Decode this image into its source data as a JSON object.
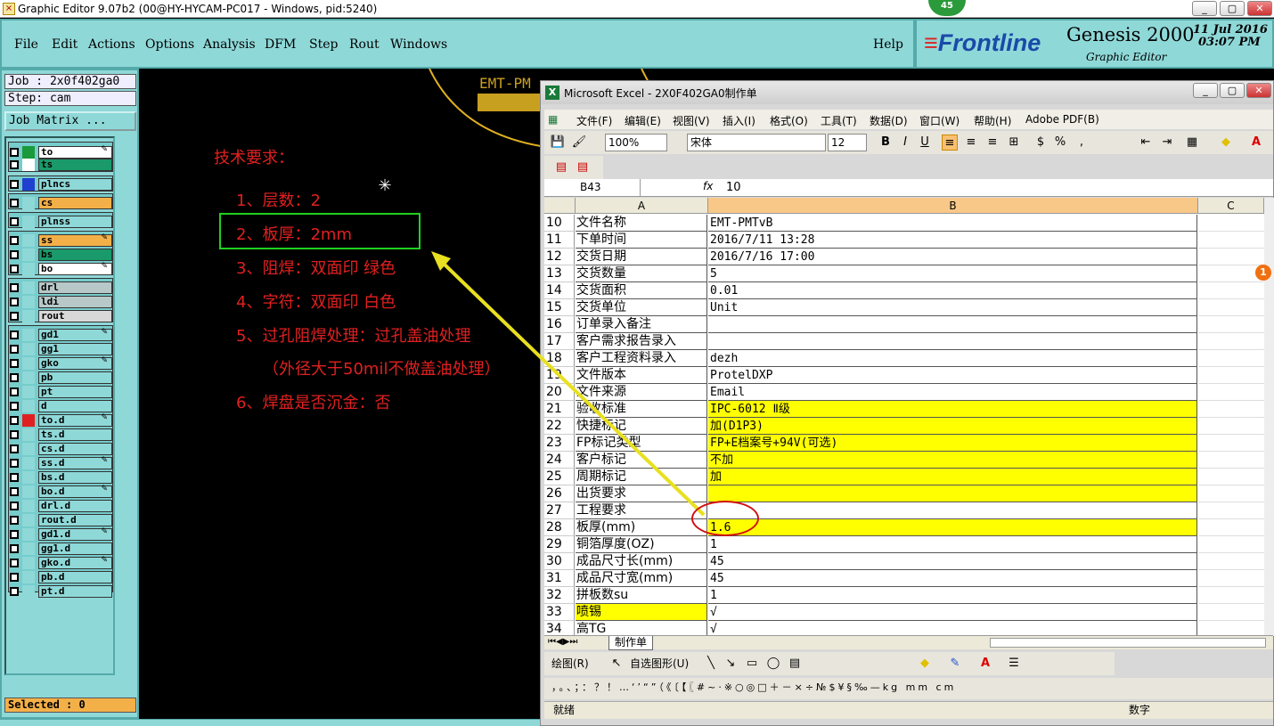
{
  "genesis": {
    "title": "Graphic Editor 9.07b2 (00@HY-HYCAM-PC017 - Windows, pid:5240)",
    "badge": "45",
    "menu": [
      "File",
      "Edit",
      "Actions",
      "Options",
      "Analysis",
      "DFM",
      "Step",
      "Rout",
      "Windows"
    ],
    "help": "Help",
    "brand": "Frontline",
    "product": "Genesis 2000",
    "product_sub": "Graphic Editor",
    "date": "11 Jul 2016",
    "time": "03:07 PM",
    "job": "Job : 2x0f402ga0",
    "step": "Step: cam",
    "job_matrix": "Job Matrix ...",
    "selected": "Selected : 0",
    "layers": [
      {
        "name": "to",
        "color": "#ffffff",
        "swatch": "#1a9a3a",
        "pen": true
      },
      {
        "name": "ts",
        "color": "#1a9a6a",
        "swatch": "#ffffff",
        "pen": false
      },
      {
        "name": "plncs",
        "color": "#8fd8d8",
        "swatch": "#2040d0",
        "pen": false
      },
      {
        "name": "cs",
        "color": "#f4b048",
        "swatch": "#8fd8d8",
        "pen": false
      },
      {
        "name": "plnss",
        "color": "#8fd8d8",
        "swatch": "#8fd8d8",
        "pen": false
      },
      {
        "name": "ss",
        "color": "#f4b048",
        "swatch": "#8fd8d8",
        "pen": true
      },
      {
        "name": "bs",
        "color": "#1a9a6a",
        "swatch": "#8fd8d8",
        "pen": false
      },
      {
        "name": "bo",
        "color": "#ffffff",
        "swatch": "#8fd8d8",
        "pen": true
      },
      {
        "name": "drl",
        "color": "#b8c8c8",
        "swatch": "#8fd8d8",
        "pen": false
      },
      {
        "name": "ldi",
        "color": "#b8c8c8",
        "swatch": "#8fd8d8",
        "pen": false
      },
      {
        "name": "rout",
        "color": "#d8d8d8",
        "swatch": "#8fd8d8",
        "pen": false
      },
      {
        "name": "gd1",
        "color": "#8fd8d8",
        "swatch": "#8fd8d8",
        "pen": true
      },
      {
        "name": "gg1",
        "color": "#8fd8d8",
        "swatch": "#8fd8d8",
        "pen": false
      },
      {
        "name": "gko",
        "color": "#8fd8d8",
        "swatch": "#8fd8d8",
        "pen": true
      },
      {
        "name": "pb",
        "color": "#8fd8d8",
        "swatch": "#8fd8d8",
        "pen": false
      },
      {
        "name": "pt",
        "color": "#8fd8d8",
        "swatch": "#8fd8d8",
        "pen": false
      },
      {
        "name": "d",
        "color": "#8fd8d8",
        "swatch": "#8fd8d8",
        "pen": false
      },
      {
        "name": "to.d",
        "color": "#8fd8d8",
        "swatch": "#e02020",
        "pen": true
      },
      {
        "name": "ts.d",
        "color": "#8fd8d8",
        "swatch": "#8fd8d8",
        "pen": false
      },
      {
        "name": "cs.d",
        "color": "#8fd8d8",
        "swatch": "#8fd8d8",
        "pen": false
      },
      {
        "name": "ss.d",
        "color": "#8fd8d8",
        "swatch": "#8fd8d8",
        "pen": true
      },
      {
        "name": "bs.d",
        "color": "#8fd8d8",
        "swatch": "#8fd8d8",
        "pen": false
      },
      {
        "name": "bo.d",
        "color": "#8fd8d8",
        "swatch": "#8fd8d8",
        "pen": true
      },
      {
        "name": "drl.d",
        "color": "#8fd8d8",
        "swatch": "#8fd8d8",
        "pen": false
      },
      {
        "name": "rout.d",
        "color": "#8fd8d8",
        "swatch": "#8fd8d8",
        "pen": false
      },
      {
        "name": "gd1.d",
        "color": "#8fd8d8",
        "swatch": "#8fd8d8",
        "pen": true
      },
      {
        "name": "gg1.d",
        "color": "#8fd8d8",
        "swatch": "#8fd8d8",
        "pen": false
      },
      {
        "name": "gko.d",
        "color": "#8fd8d8",
        "swatch": "#8fd8d8",
        "pen": true
      },
      {
        "name": "pb.d",
        "color": "#8fd8d8",
        "swatch": "#8fd8d8",
        "pen": false
      },
      {
        "name": "pt.d",
        "color": "#8fd8d8",
        "swatch": "#8fd8d8",
        "pen": false
      }
    ],
    "board_label": "EMT-PM",
    "tech_heading": "技术要求：",
    "tech_lines": [
      "1、层数：2",
      "2、板厚：2mm",
      "3、阻焊：双面印 绿色",
      "4、字符：双面印 白色",
      "5、过孔阻焊处理：过孔盖油处理",
      "（外径大于50mil不做盖油处理）",
      "6、焊盘是否沉金：否"
    ]
  },
  "excel": {
    "title": "Microsoft Excel - 2X0F402GA0制作单",
    "menu": [
      "文件(F)",
      "编辑(E)",
      "视图(V)",
      "插入(I)",
      "格式(O)",
      "工具(T)",
      "数据(D)",
      "窗口(W)",
      "帮助(H)",
      "Adobe PDF(B)"
    ],
    "zoom": "100%",
    "font": "宋体",
    "font_size": "12",
    "name_box": "B43",
    "fx": "fx",
    "formula_value": "10",
    "columns": [
      "A",
      "B",
      "C"
    ],
    "rows": [
      {
        "n": "10",
        "a": "文件名称",
        "b": "EMT-PMTvB",
        "hl_a": false,
        "hl_b": false
      },
      {
        "n": "11",
        "a": "下单时间",
        "b": "2016/7/11 13:28",
        "hl_a": false,
        "hl_b": false
      },
      {
        "n": "12",
        "a": "交货日期",
        "b": "2016/7/16 17:00",
        "hl_a": false,
        "hl_b": false
      },
      {
        "n": "13",
        "a": "交货数量",
        "b": "5",
        "hl_a": false,
        "hl_b": false
      },
      {
        "n": "14",
        "a": "交货面积",
        "b": "0.01",
        "hl_a": false,
        "hl_b": false
      },
      {
        "n": "15",
        "a": "交货单位",
        "b": "Unit",
        "hl_a": false,
        "hl_b": false
      },
      {
        "n": "16",
        "a": "订单录入备注",
        "b": "",
        "hl_a": false,
        "hl_b": false
      },
      {
        "n": "17",
        "a": "客户需求报告录入",
        "b": "",
        "hl_a": false,
        "hl_b": false
      },
      {
        "n": "18",
        "a": "客户工程资料录入",
        "b": "dezh",
        "hl_a": false,
        "hl_b": false
      },
      {
        "n": "19",
        "a": "文件版本",
        "b": "ProtelDXP",
        "hl_a": false,
        "hl_b": false
      },
      {
        "n": "20",
        "a": "文件来源",
        "b": "Email",
        "hl_a": false,
        "hl_b": false
      },
      {
        "n": "21",
        "a": "验收标准",
        "b": "IPC-6012 Ⅱ级",
        "hl_a": false,
        "hl_b": true
      },
      {
        "n": "22",
        "a": "快捷标记",
        "b": "加(D1P3)",
        "hl_a": false,
        "hl_b": true
      },
      {
        "n": "23",
        "a": "FP标记类型",
        "b": "FP+E档案号+94V(可选)",
        "hl_a": false,
        "hl_b": true
      },
      {
        "n": "24",
        "a": "客户标记",
        "b": "不加",
        "hl_a": false,
        "hl_b": true
      },
      {
        "n": "25",
        "a": "周期标记",
        "b": "加",
        "hl_a": false,
        "hl_b": true
      },
      {
        "n": "26",
        "a": "出货要求",
        "b": "",
        "hl_a": false,
        "hl_b": true
      },
      {
        "n": "27",
        "a": "工程要求",
        "b": "",
        "hl_a": false,
        "hl_b": false
      },
      {
        "n": "28",
        "a": "板厚(mm)",
        "b": "1.6",
        "hl_a": false,
        "hl_b": true
      },
      {
        "n": "29",
        "a": "铜箔厚度(OZ)",
        "b": "1",
        "hl_a": false,
        "hl_b": false
      },
      {
        "n": "30",
        "a": "成品尺寸长(mm)",
        "b": "45",
        "hl_a": false,
        "hl_b": false
      },
      {
        "n": "31",
        "a": "成品尺寸宽(mm)",
        "b": "45",
        "hl_a": false,
        "hl_b": false
      },
      {
        "n": "32",
        "a": "拼板数su",
        "b": "1",
        "hl_a": false,
        "hl_b": false
      },
      {
        "n": "33",
        "a": "喷锡",
        "b": "√",
        "hl_a": true,
        "hl_b": false
      },
      {
        "n": "34",
        "a": "高TG",
        "b": "√",
        "hl_a": false,
        "hl_b": false
      }
    ],
    "sheet_tab": "制作单",
    "draw_toolbar": [
      "绘图(R)",
      "自选图形(U)"
    ],
    "symbols": "，。、；：？！…‘’“”（《〔【〖#~·※○◎□＋－×÷№$¥§‰—kg mm cm",
    "status_left": "就绪",
    "status_right": "数字"
  },
  "notif_count": "1"
}
